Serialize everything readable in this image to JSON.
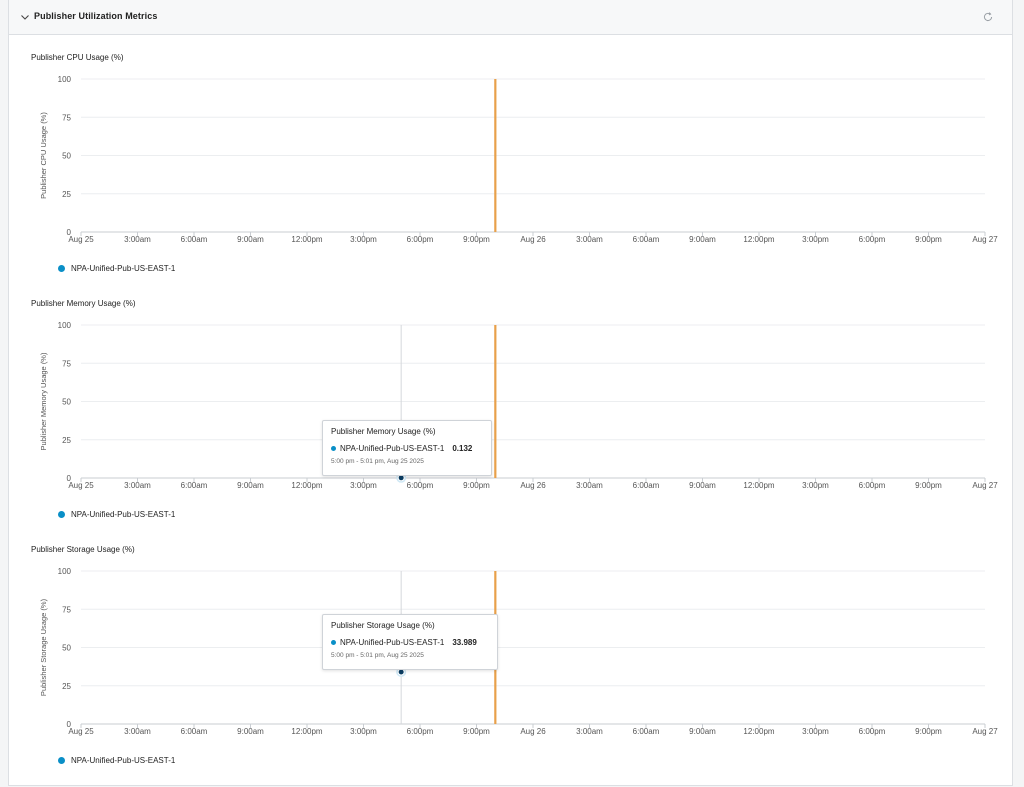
{
  "panel": {
    "title": "Publisher Utilization Metrics",
    "collapse_icon": "chevron-down-icon",
    "refresh_icon": "refresh-icon"
  },
  "colors": {
    "series": "#0a8fc7",
    "marker_line": "#e8a04a",
    "grid": "#eceef0",
    "axis_text": "#555555"
  },
  "chart_data": [
    {
      "type": "line",
      "title": "Publisher CPU Usage (%)",
      "ylabel": "Publisher CPU Usage (%)",
      "ylim": [
        0,
        100
      ],
      "yticks": [
        "0",
        "25",
        "50",
        "75",
        "100"
      ],
      "xticks": [
        "Aug 25",
        "3:00am",
        "6:00am",
        "9:00am",
        "12:00pm",
        "3:00pm",
        "6:00pm",
        "9:00pm",
        "Aug 26",
        "3:00am",
        "6:00am",
        "9:00am",
        "12:00pm",
        "3:00pm",
        "6:00pm",
        "9:00pm",
        "Aug 27"
      ],
      "series": [
        {
          "name": "NPA-Unified-Pub-US-EAST-1",
          "points": []
        }
      ],
      "marker_x": "Aug 25 ~10:00pm",
      "legend": "bottom-left",
      "grid": true,
      "tooltip": null
    },
    {
      "type": "line",
      "title": "Publisher Memory Usage (%)",
      "ylabel": "Publisher Memory Usage (%)",
      "ylim": [
        0,
        100
      ],
      "yticks": [
        "0",
        "25",
        "50",
        "75",
        "100"
      ],
      "xticks": [
        "Aug 25",
        "3:00am",
        "6:00am",
        "9:00am",
        "12:00pm",
        "3:00pm",
        "6:00pm",
        "9:00pm",
        "Aug 26",
        "3:00am",
        "6:00am",
        "9:00am",
        "12:00pm",
        "3:00pm",
        "6:00pm",
        "9:00pm",
        "Aug 27"
      ],
      "series": [
        {
          "name": "NPA-Unified-Pub-US-EAST-1",
          "points": [
            {
              "x": "Aug 25 5:00pm",
              "y": 0.132
            }
          ]
        }
      ],
      "marker_x": "Aug 25 ~10:00pm",
      "legend": "bottom-left",
      "grid": true,
      "tooltip": {
        "title": "Publisher Memory Usage (%)",
        "series": "NPA-Unified-Pub-US-EAST-1",
        "value": "0.132",
        "time": "5:00 pm - 5:01 pm, Aug 25 2025"
      }
    },
    {
      "type": "line",
      "title": "Publisher Storage Usage (%)",
      "ylabel": "Publisher Storage Usage (%)",
      "ylim": [
        0,
        100
      ],
      "yticks": [
        "0",
        "25",
        "50",
        "75",
        "100"
      ],
      "xticks": [
        "Aug 25",
        "3:00am",
        "6:00am",
        "9:00am",
        "12:00pm",
        "3:00pm",
        "6:00pm",
        "9:00pm",
        "Aug 26",
        "3:00am",
        "6:00am",
        "9:00am",
        "12:00pm",
        "3:00pm",
        "6:00pm",
        "9:00pm",
        "Aug 27"
      ],
      "series": [
        {
          "name": "NPA-Unified-Pub-US-EAST-1",
          "points": [
            {
              "x": "Aug 25 5:00pm",
              "y": 33.989
            }
          ]
        }
      ],
      "marker_x": "Aug 25 ~10:00pm",
      "legend": "bottom-left",
      "grid": true,
      "tooltip": {
        "title": "Publisher Storage Usage (%)",
        "series": "NPA-Unified-Pub-US-EAST-1",
        "value": "33.989",
        "time": "5:00 pm - 5:01 pm, Aug 25 2025"
      }
    }
  ]
}
